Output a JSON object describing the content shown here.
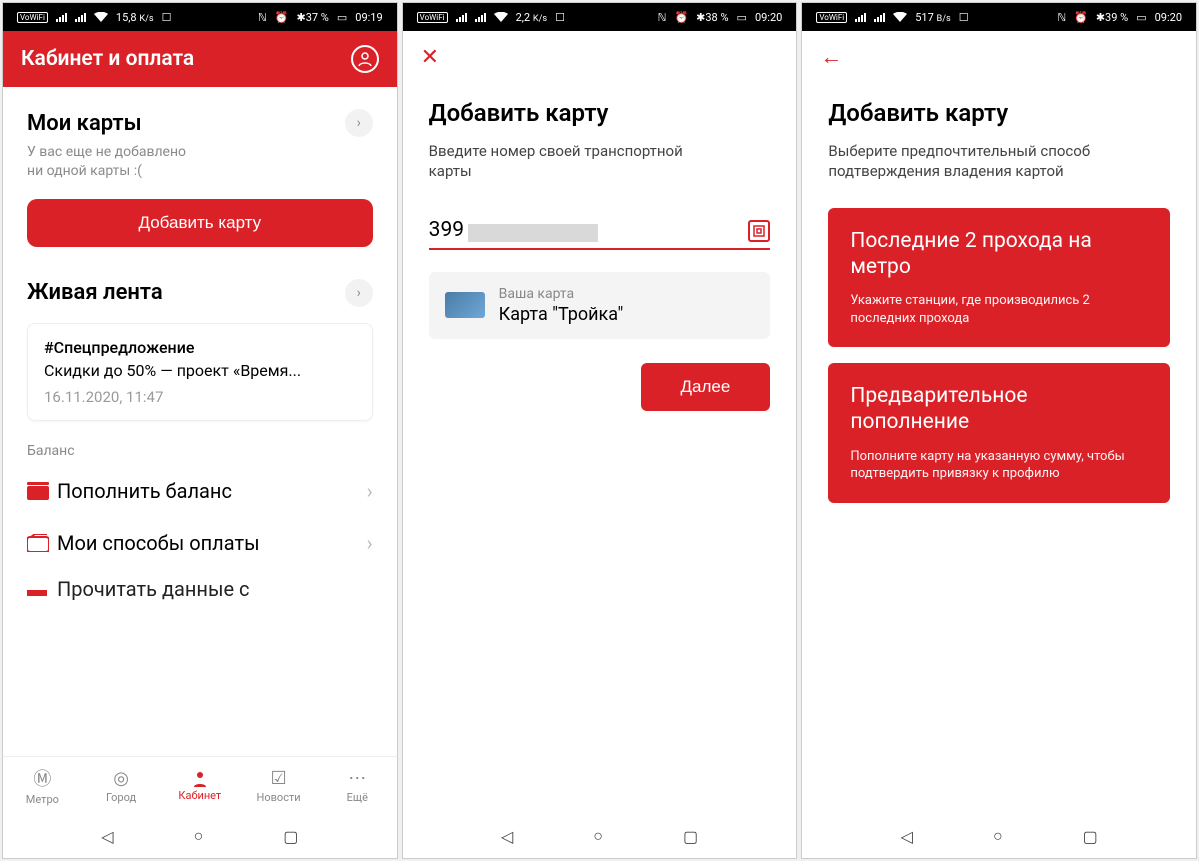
{
  "status": {
    "s1": {
      "speed": "15,8",
      "unit": "K/s",
      "bt": "37 %",
      "time": "09:19"
    },
    "s2": {
      "speed": "2,2",
      "unit": "K/s",
      "bt": "38 %",
      "time": "09:20"
    },
    "s3": {
      "speed": "517",
      "unit": "B/s",
      "bt": "39 %",
      "time": "09:20"
    },
    "vowifi": "VoWiFi"
  },
  "screen1": {
    "appbar_title": "Кабинет и оплата",
    "my_cards_title": "Мои карты",
    "my_cards_empty": "У вас еще не добавлено\nни одной карты :(",
    "add_card_btn": "Добавить карту",
    "feed_title": "Живая лента",
    "feed_item_tag": "#Спецпредложение",
    "feed_item_text": "Скидки до 50% — проект «Время...",
    "feed_item_date": "16.11.2020, 11:47",
    "balance_label": "Баланс",
    "row_topup": "Пополнить баланс",
    "row_methods": "Мои способы оплаты",
    "row_partial": "Прочитать данные с",
    "nav": [
      "Метро",
      "Город",
      "Кабинет",
      "Новости",
      "Ещё"
    ]
  },
  "screen2": {
    "title": "Добавить карту",
    "subtitle": "Введите номер своей транспортной\nкарты",
    "input_prefix": "399",
    "card_label": "Ваша карта",
    "card_name": "Карта \"Тройка\"",
    "next_btn": "Далее"
  },
  "screen3": {
    "title": "Добавить карту",
    "subtitle": "Выберите предпочтительный способ\nподтверждения владения картой",
    "opt1_title": "Последние 2 прохода на метро",
    "opt1_desc": "Укажите станции, где производились 2 последних прохода",
    "opt2_title": "Предварительное пополнение",
    "opt2_desc": "Пополните карту на указанную сумму, чтобы подтвердить привязку к профилю"
  }
}
